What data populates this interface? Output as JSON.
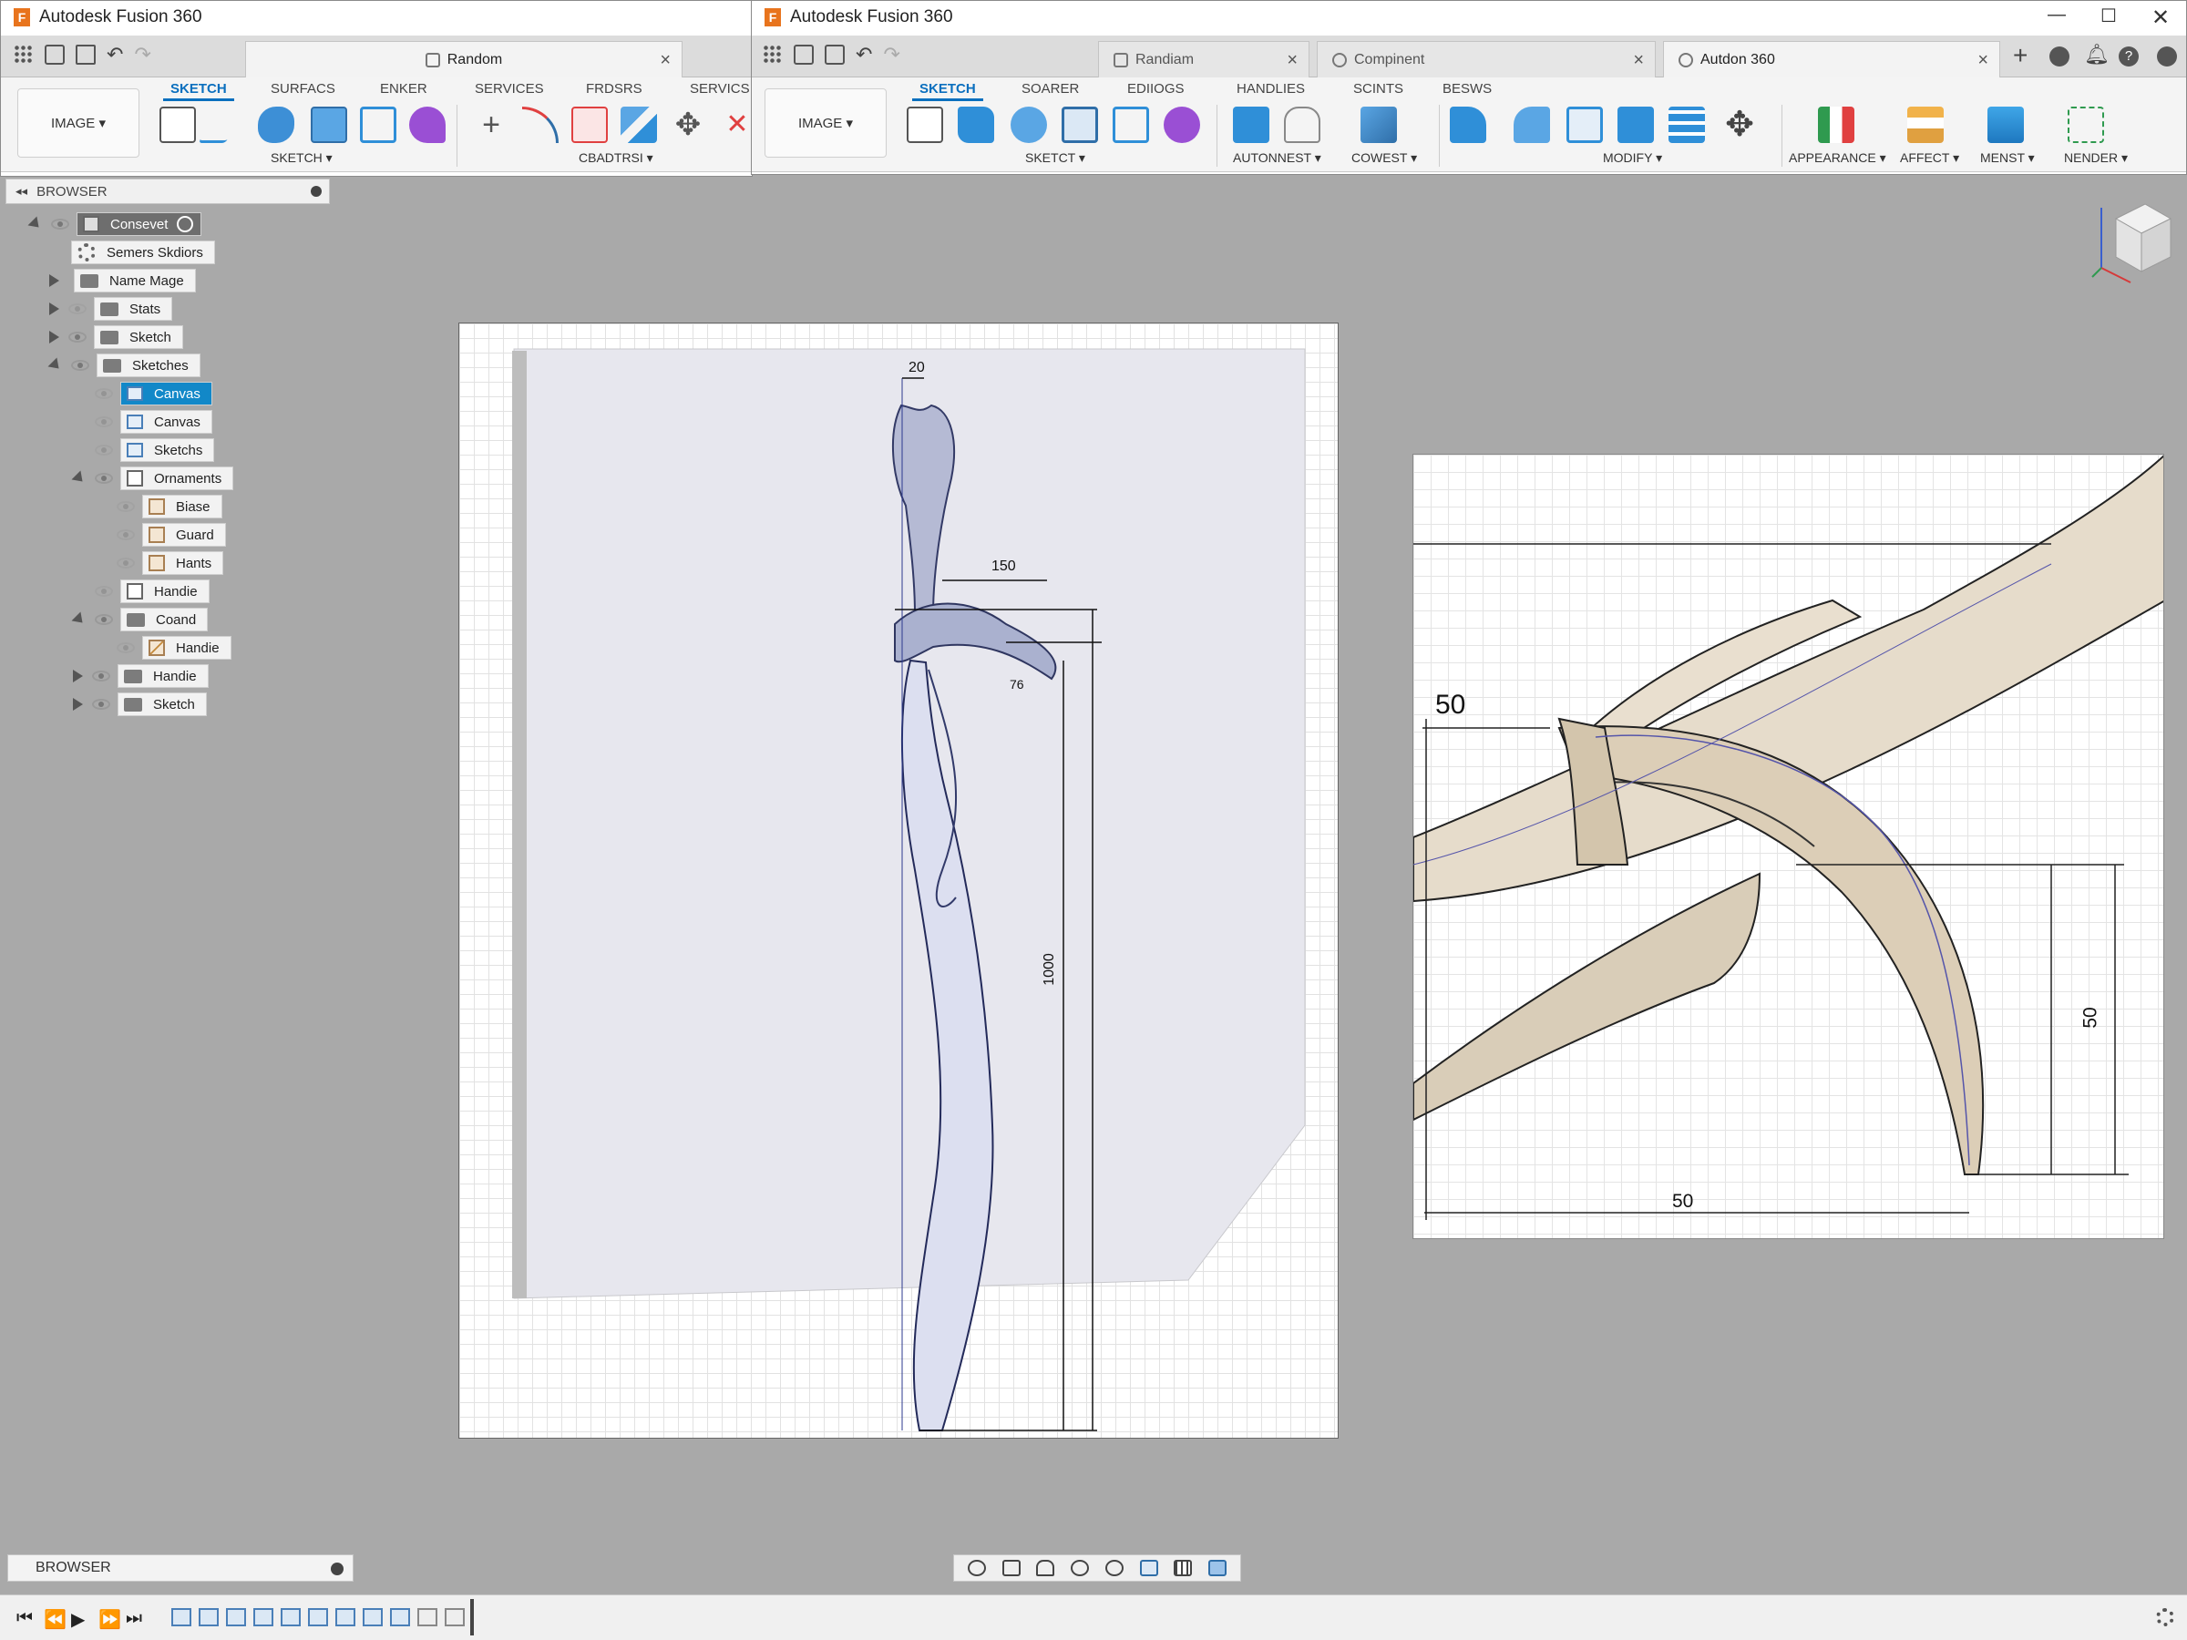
{
  "windows": {
    "left": {
      "title": "Autodesk Fusion 360",
      "doc_tab": "Random",
      "image_btn": "IMAGE",
      "ribbon_tabs": [
        "SKETCH",
        "SURFACS",
        "ENKER",
        "SERVICES",
        "FRDSRS",
        "SERVICS"
      ],
      "groups": [
        "SKETCH",
        "CBADTRSI"
      ]
    },
    "right": {
      "title": "Autodesk Fusion 360",
      "doc_tabs": [
        "Randiam",
        "Compinent",
        "Autdon 360"
      ],
      "image_btn": "IMAGE",
      "ribbon_tabs": [
        "SKETCH",
        "SOARER",
        "EDIIOGS",
        "HANDLIES",
        "SCINTS",
        "BESWS"
      ],
      "groups": [
        "SKETCT",
        "AUTONNEST",
        "COWEST",
        "MODIFY",
        "APPEARANCE",
        "AFFECT",
        "MENST",
        "NENDER"
      ]
    }
  },
  "browser": {
    "header": "BROWSER",
    "root": "Consevet",
    "items": [
      "Semers Skdiors",
      "Name Mage",
      "Stats",
      "Sketch",
      "Sketches",
      "Canvas",
      "Canvas",
      "Sketchs",
      "Ornaments",
      "Biase",
      "Guard",
      "Hants",
      "Handie",
      "Coand",
      "Handie",
      "Handie",
      "Sketch"
    ]
  },
  "canvas_left": {
    "dims": [
      "20",
      "150",
      "76",
      "1000"
    ]
  },
  "canvas_right": {
    "dims": [
      "50",
      "50",
      "50"
    ]
  },
  "bottom": {
    "browser_label": "BROWSER"
  },
  "colors": {
    "accent": "#0a6fbe",
    "selected": "#1288c8",
    "fusion_orange": "#e8741d"
  }
}
